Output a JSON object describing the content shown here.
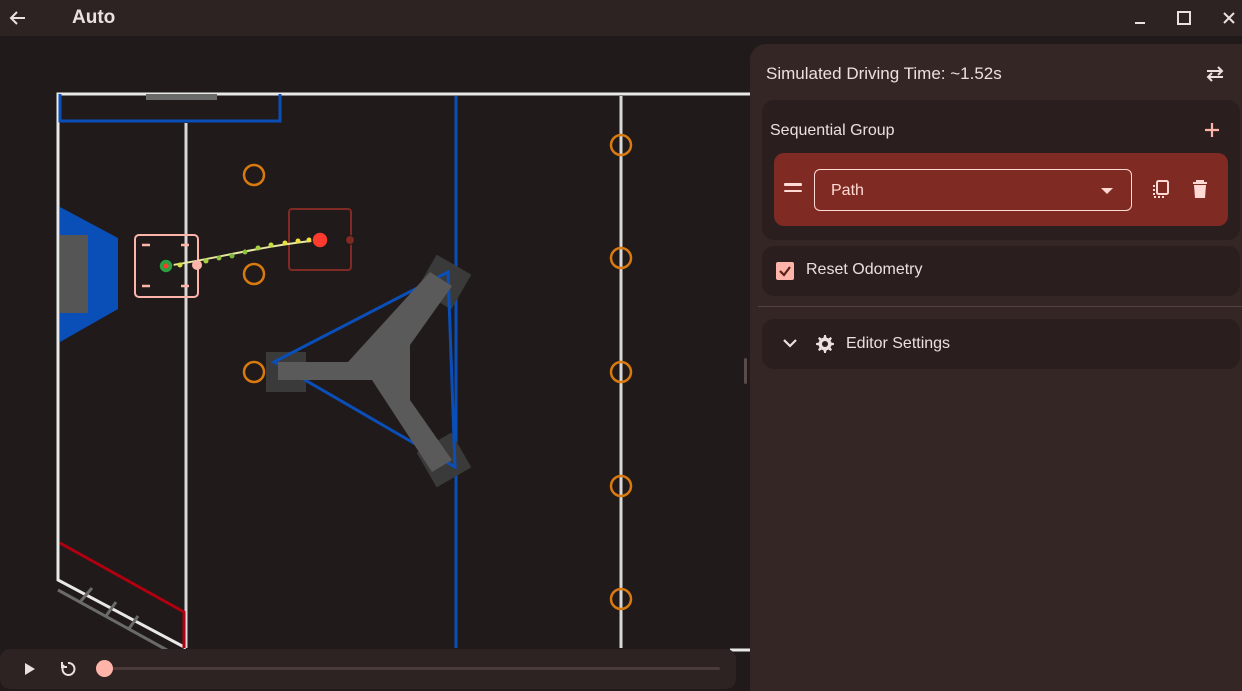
{
  "window": {
    "title": "Auto"
  },
  "panel": {
    "simulated_time": "Simulated Driving Time: ~1.52s",
    "sequential_group": {
      "title": "Sequential Group",
      "command": {
        "type_label": "Path"
      }
    },
    "reset_odometry": {
      "label": "Reset Odometry",
      "checked": true
    },
    "editor_settings": {
      "label": "Editor Settings"
    }
  },
  "playback": {
    "progress": 0.0
  },
  "colors": {
    "accent": "#ffb4a9",
    "path_item_bg": "#7f2a23",
    "field_blue": "#0a4fb8",
    "field_red": "#b00010",
    "note_orange": "#d97a10",
    "waypoint_green": "#2e9e3e",
    "waypoint_red": "#ff3b2f"
  },
  "icons": {
    "back": "arrow-left-icon",
    "minimize": "minimize-icon",
    "maximize": "maximize-icon",
    "close": "close-icon",
    "swap": "swap-horiz-icon",
    "add": "plus-icon",
    "drag": "drag-handle-icon",
    "copy": "copy-icon",
    "delete": "trash-icon",
    "chevron": "chevron-down-icon",
    "settings": "gear-icon",
    "play": "play-icon",
    "restart": "restart-icon"
  }
}
